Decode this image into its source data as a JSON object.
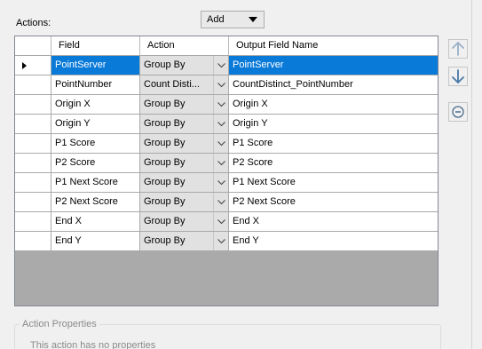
{
  "actions_label": "Actions:",
  "add_dropdown": {
    "label": "Add"
  },
  "grid": {
    "headers": {
      "field": "Field",
      "action": "Action",
      "output": "Output Field Name"
    },
    "rows": [
      {
        "field": "PointServer",
        "action": "Group By",
        "output": "PointServer",
        "selected": true
      },
      {
        "field": "PointNumber",
        "action": "Count Disti...",
        "output": "CountDistinct_PointNumber",
        "selected": false
      },
      {
        "field": "Origin X",
        "action": "Group By",
        "output": "Origin X",
        "selected": false
      },
      {
        "field": "Origin Y",
        "action": "Group By",
        "output": "Origin Y",
        "selected": false
      },
      {
        "field": "P1 Score",
        "action": "Group By",
        "output": "P1 Score",
        "selected": false
      },
      {
        "field": "P2 Score",
        "action": "Group By",
        "output": "P2 Score",
        "selected": false
      },
      {
        "field": "P1 Next Score",
        "action": "Group By",
        "output": "P1 Next Score",
        "selected": false
      },
      {
        "field": "P2 Next Score",
        "action": "Group By",
        "output": "P2 Next Score",
        "selected": false
      },
      {
        "field": "End X",
        "action": "Group By",
        "output": "End X",
        "selected": false
      },
      {
        "field": "End Y",
        "action": "Group By",
        "output": "End Y",
        "selected": false
      }
    ]
  },
  "side_buttons": {
    "move_up_icon": "arrow-up-icon",
    "move_down_icon": "arrow-down-icon",
    "remove_icon": "minus-circle-icon"
  },
  "action_properties": {
    "legend": "Action Properties",
    "message": "This action has no properties"
  },
  "colors": {
    "selection": "#0a7ad9",
    "grid_background": "#aaaaaa",
    "window_background": "#f0f0f0"
  }
}
